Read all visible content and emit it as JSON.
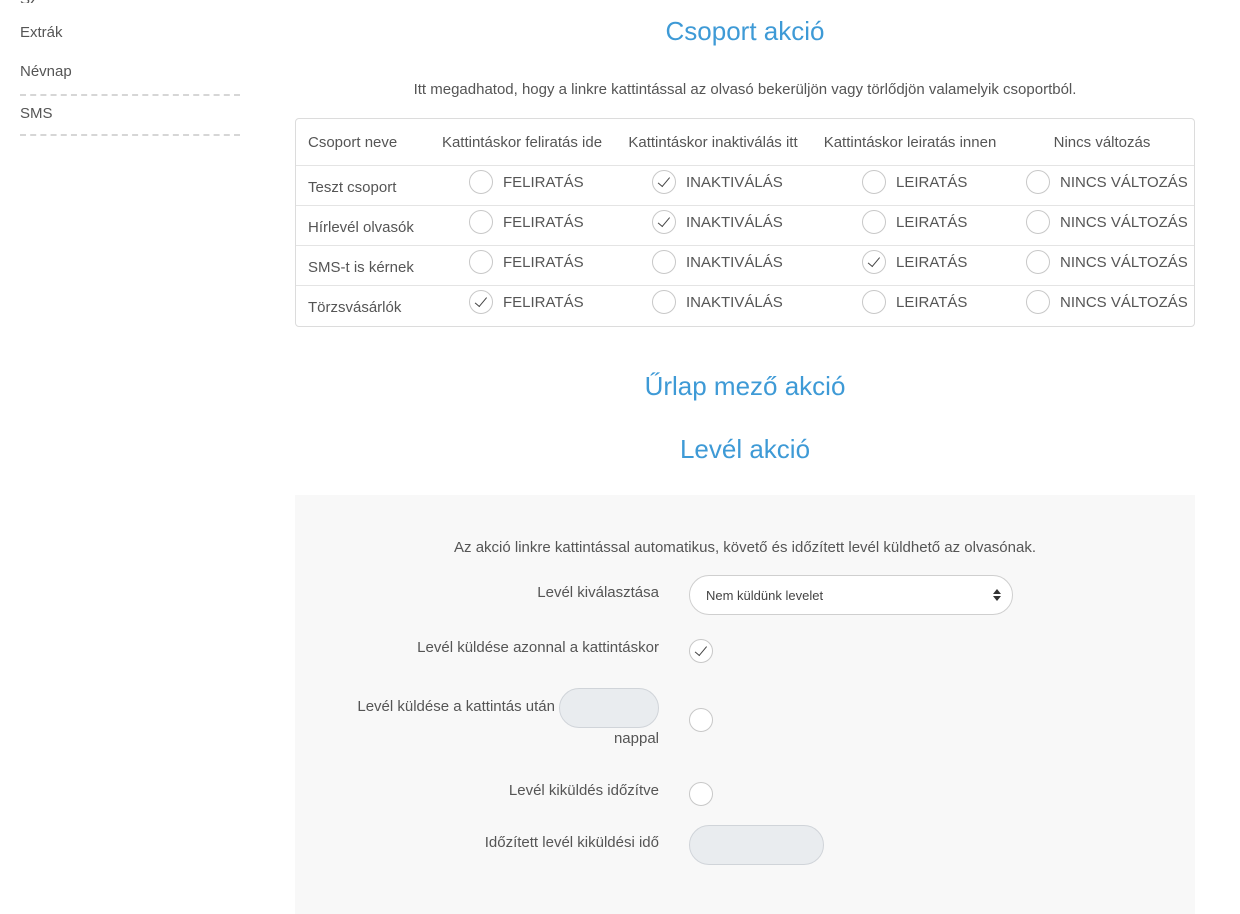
{
  "sidebar": {
    "partial_top": "Sz",
    "items": [
      {
        "label": "Extrák"
      },
      {
        "label": "Névnap"
      },
      {
        "label": "SMS"
      }
    ]
  },
  "group_action": {
    "title": "Csoport akció",
    "intro": "Itt megadhatod, hogy a linkre kattintással az olvasó bekerüljön vagy törlődjön valamelyik csoportból.",
    "columns": [
      "Csoport neve",
      "Kattintáskor feliratás ide",
      "Kattintáskor inaktiválás itt",
      "Kattintáskor leiratás innen",
      "Nincs változás"
    ],
    "option_labels": [
      "FELIRATÁS",
      "INAKTIVÁLÁS",
      "LEIRATÁS",
      "NINCS VÁLTOZÁS"
    ],
    "rows": [
      {
        "name": "Teszt csoport",
        "selected": 1
      },
      {
        "name": "Hírlevél olvasók",
        "selected": 1
      },
      {
        "name": "SMS-t is kérnek",
        "selected": 2
      },
      {
        "name": "Törzsvásárlók",
        "selected": 0
      }
    ]
  },
  "form_field_action": {
    "title": "Űrlap mező akció"
  },
  "mail_action": {
    "title": "Levél akció",
    "intro": "Az akció linkre kattintással automatikus, követő és időzített levél küldhető az olvasónak.",
    "select_label": "Levél kiválasztása",
    "select_value": "Nem küldünk levelet",
    "send_now_label": "Levél küldése azonnal a kattintáskor",
    "send_now_checked": true,
    "send_after_label": "Levél küldése a kattintás után",
    "send_after_unit": "nappal",
    "send_after_value": "",
    "send_after_checked": false,
    "scheduled_label": "Levél kiküldés időzítve",
    "scheduled_checked": false,
    "scheduled_time_label": "Időzített levél kiküldési idő",
    "scheduled_time_value": ""
  }
}
